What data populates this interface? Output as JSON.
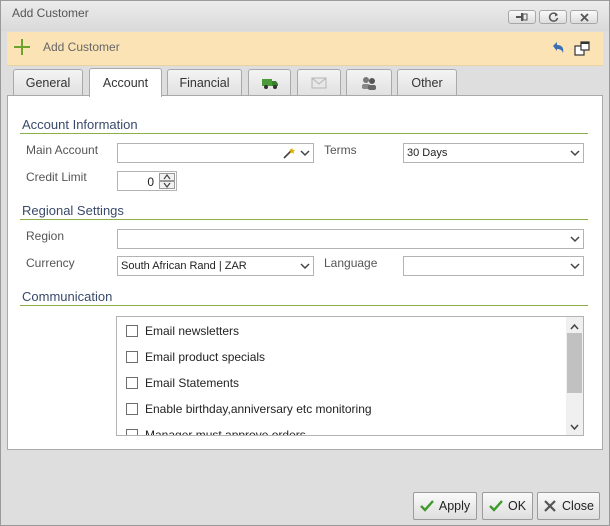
{
  "window": {
    "title": "Add Customer"
  },
  "toolbar": {
    "title": "Add Customer"
  },
  "tabs": [
    {
      "label": "General"
    },
    {
      "label": "Account"
    },
    {
      "label": "Financial"
    },
    {
      "label": ""
    },
    {
      "label": ""
    },
    {
      "label": ""
    },
    {
      "label": "Other"
    }
  ],
  "account_info": {
    "section_title": "Account Information",
    "main_account_label": "Main Account",
    "main_account_value": "",
    "terms_label": "Terms",
    "terms_value": "30 Days",
    "credit_limit_label": "Credit Limit",
    "credit_limit_value": "0"
  },
  "regional": {
    "section_title": "Regional Settings",
    "region_label": "Region",
    "region_value": "",
    "currency_label": "Currency",
    "currency_value": "South African Rand | ZAR",
    "language_label": "Language",
    "language_value": ""
  },
  "communication": {
    "section_title": "Communication",
    "items": [
      {
        "label": "Email newsletters",
        "checked": false
      },
      {
        "label": "Email product specials",
        "checked": false
      },
      {
        "label": "Email Statements",
        "checked": false
      },
      {
        "label": "Enable birthday,anniversary etc monitoring",
        "checked": false
      },
      {
        "label": "Manager must approve orders",
        "checked": false
      }
    ]
  },
  "buttons": {
    "apply": "Apply",
    "ok": "OK",
    "close": "Close"
  },
  "colors": {
    "toolbar_bg": "#fbe3b6",
    "section_line": "#8bb04a",
    "accent_green": "#6aa42d"
  }
}
